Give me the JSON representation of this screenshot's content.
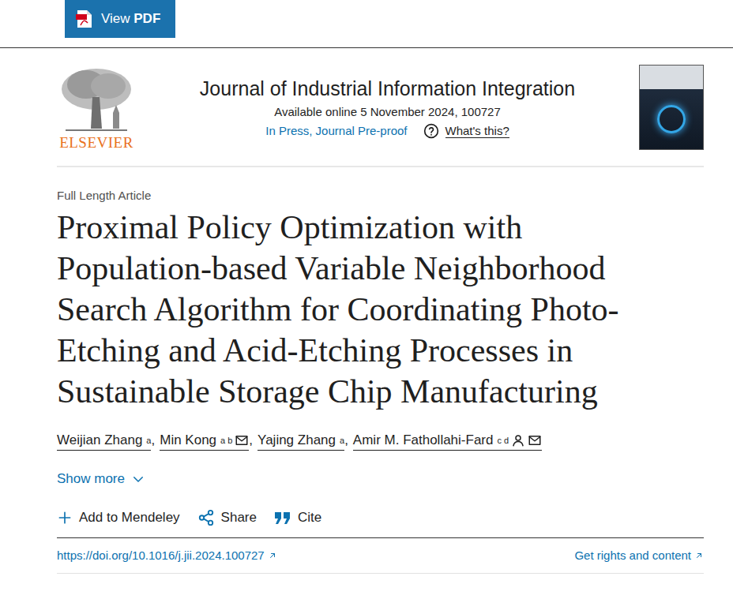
{
  "toolbar": {
    "button": {
      "label": "View",
      "format": "PDF"
    }
  },
  "journal": {
    "publisher": "ELSEVIER",
    "title": "Journal of Industrial Information Integration",
    "available": "Available online 5 November 2024, 100727",
    "status_link": "In Press, Journal Pre-proof",
    "help_link": "What's this?"
  },
  "article": {
    "type": "Full Length Article",
    "title": "Proximal Policy Optimization with Population-based Variable Neighborhood Search Algorithm for Coordinating Photo-Etching and Acid-Etching Processes in Sustainable Storage Chip Manufacturing",
    "author_separator": ",",
    "authors": [
      {
        "name": "Weijian Zhang",
        "affiliations": "a",
        "profile": false,
        "email": false
      },
      {
        "name": "Min Kong",
        "affiliations": "a b",
        "profile": false,
        "email": true
      },
      {
        "name": "Yajing Zhang",
        "affiliations": "a",
        "profile": false,
        "email": false
      },
      {
        "name": "Amir M. Fathollahi-Fard",
        "affiliations": "c d",
        "profile": true,
        "email": true
      }
    ],
    "show_more": "Show more"
  },
  "actions": [
    {
      "label": "Add to Mendeley",
      "kind": "add"
    },
    {
      "label": "Share",
      "kind": "share"
    },
    {
      "label": "Cite",
      "kind": "cite"
    }
  ],
  "links": {
    "doi": "https://doi.org/10.1016/j.jii.2024.100727",
    "rights": "Get rights and content"
  }
}
